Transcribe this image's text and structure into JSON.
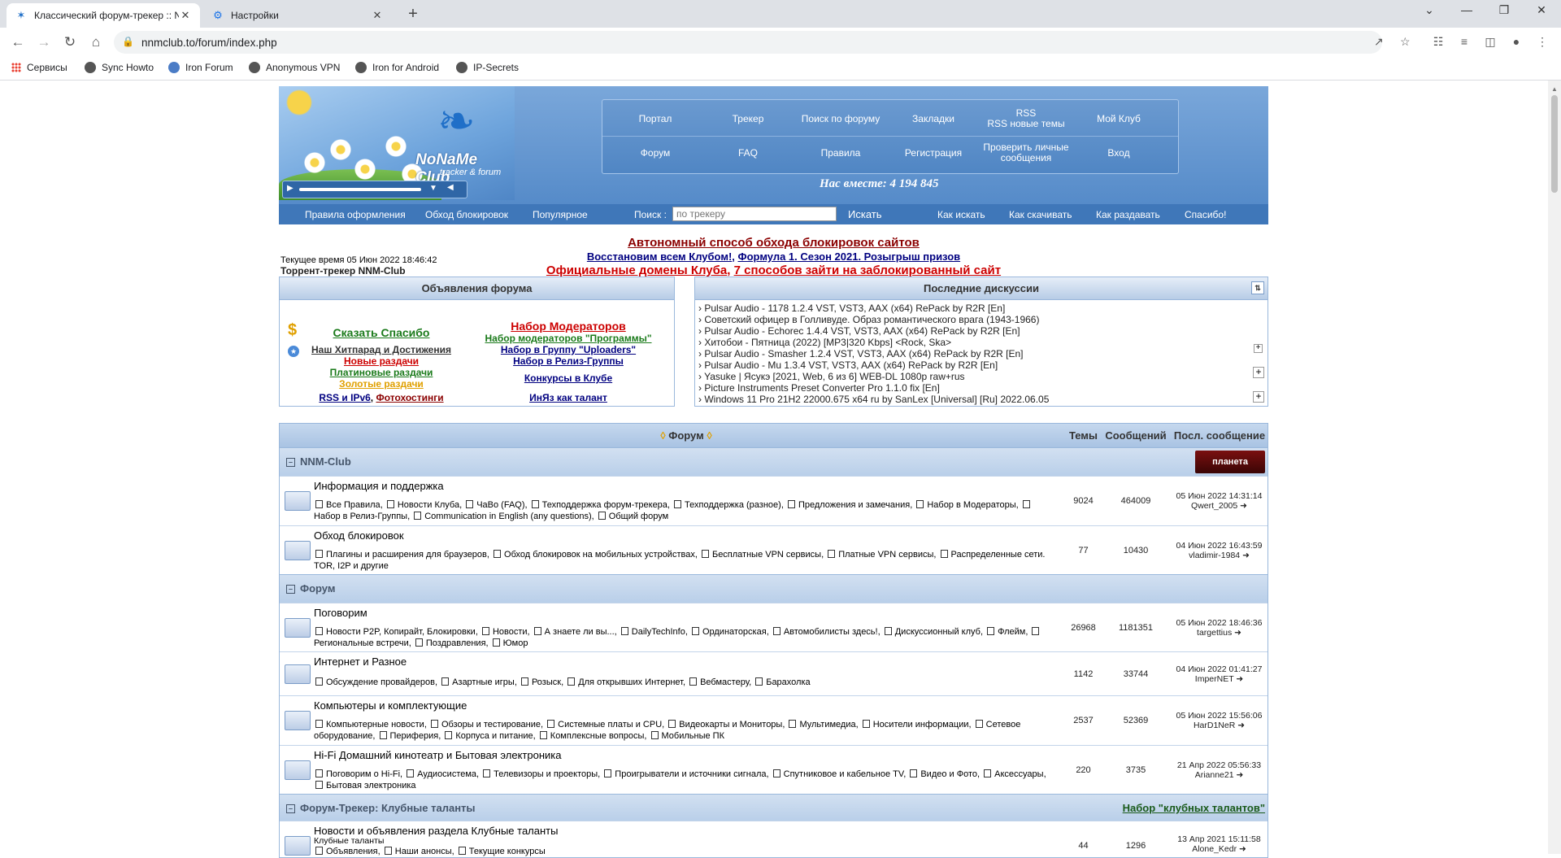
{
  "browser": {
    "tabs": [
      {
        "title": "Классический форум-трекер :: N",
        "active": true
      },
      {
        "title": "Настройки",
        "active": false
      }
    ],
    "url": "nnmclub.to/forum/index.php",
    "bookmarks": [
      "Сервисы",
      "Sync Howto",
      "Iron Forum",
      "Anonymous VPN",
      "Iron for Android",
      "IP-Secrets"
    ]
  },
  "header": {
    "logo_text": "NoNaMe Club",
    "logo_sub": "tracker & forum",
    "nav_row1": [
      "Портал",
      "Трекер",
      "Поиск по форуму",
      "Закладки",
      "RSS\nRSS новые темы",
      "Мой Клуб"
    ],
    "nav_row2": [
      "Форум",
      "FAQ",
      "Правила",
      "Регистрация",
      "Проверить личные сообщения",
      "Вход"
    ],
    "together": "Нас вместе: 4 194 845"
  },
  "menubar": {
    "left": [
      "Правила оформления",
      "Обход блокировок",
      "Популярное"
    ],
    "search_label": "Поиск :",
    "search_placeholder": "по трекеру",
    "search_button": "Искать",
    "right": [
      "Как искать",
      "Как скачивать",
      "Как раздавать",
      "Спасибо!"
    ]
  },
  "info": {
    "time": "Текущее время 05 Июн 2022 18:46:42",
    "tracker": "Торрент-трекер NNM-Club",
    "announce1": "Автономный способ обхода блокировок сайтов",
    "announce2a": "Восстановим всем Клубом!",
    "announce2b": "Формула 1. Сезон 2021. Розыгрыш призов",
    "announce3a": "Официальные домены Клуба",
    "announce3b": "7 способов зайти на заблокированный сайт"
  },
  "announcements": {
    "title": "Объявления форума",
    "left": [
      {
        "text": "Сказать Спасибо",
        "color": "#1a7a1a"
      },
      {
        "text": "Наш Хитпарад и Достижения",
        "color": "#333333"
      },
      {
        "text": "Новые раздачи",
        "color": "#cc0000"
      },
      {
        "text": "Платиновые раздачи",
        "color": "#1a7a1a"
      },
      {
        "text": "Золотые раздачи",
        "color": "#e0a000"
      },
      {
        "text": "RSS и IPv6",
        "color": "#000080"
      },
      {
        "text": "Фотохостинги",
        "color": "#8b0000"
      }
    ],
    "right": [
      {
        "text": "Набор Модераторов",
        "color": "#cc0000"
      },
      {
        "text": "Набор модераторов \"Программы\"",
        "color": "#1a7a1a"
      },
      {
        "text": "Набор в Группу \"Uploaders\"",
        "color": "#000080"
      },
      {
        "text": "Набор в Релиз-Группы",
        "color": "#000080"
      },
      {
        "text": "Конкурсы в Клубе",
        "color": "#000080"
      },
      {
        "text": "ИнЯз как талант",
        "color": "#000080"
      }
    ]
  },
  "discussions": {
    "title": "Последние дискуссии",
    "items": [
      "Pulsar Audio - 1178 1.2.4 VST, VST3, AAX (x64) RePack by R2R [En]",
      "Советский офицер в Голливуде. Образ романтического врага (1943-1966)",
      "Pulsar Audio - Echorec 1.4.4 VST, VST3, AAX (x64) RePack by R2R [En]",
      "Хитобои - Пятница (2022) [MP3|320 Kbps] <Rock, Ska>",
      "Pulsar Audio - Smasher 1.2.4 VST, VST3, AAX (x64) RePack by R2R [En]",
      "Pulsar Audio - Mu 1.3.4 VST, VST3, AAX (x64) RePack by R2R [En]",
      "Yasuke | Ясукэ [2021, Web, 6 из 6] WEB-DL 1080p raw+rus",
      "Picture Instruments Preset Converter Pro 1.1.0 fix [En]",
      "Windows 11 Pro 21H2 22000.675 x64 ru by SanLex [Universal] [Ru] 2022.06.05"
    ]
  },
  "forum": {
    "headers": {
      "forum": "Форум",
      "topics": "Темы",
      "posts": "Сообщений",
      "last": "Посл. сообщение"
    },
    "badge_text": "планета",
    "categories": [
      {
        "name": "NNM-Club",
        "rows": [
          {
            "title": "Информация и поддержка",
            "subs": [
              "Все Правила",
              "Новости Клуба",
              "ЧаВо (FAQ)",
              "Техподдержка форум-трекера",
              "Техподдержка (разное)",
              "Предложения и замечания",
              "Набор в Модераторы",
              "Набор в Релиз-Группы",
              "Communication in English (any questions)",
              "Общий форум"
            ],
            "topics": "9024",
            "posts": "464009",
            "last_date": "05 Июн 2022 14:31:14",
            "last_user": "Qwert_2005"
          },
          {
            "title": "Обход блокировок",
            "subs": [
              "Плагины и расширения для браузеров",
              "Обход блокировок на мобильных устройствах",
              "Бесплатные VPN сервисы",
              "Платные VPN сервисы",
              "Распределенные сети. TOR, I2P и другие"
            ],
            "topics": "77",
            "posts": "10430",
            "last_date": "04 Июн 2022 16:43:59",
            "last_user": "vladimir-1984"
          }
        ]
      },
      {
        "name": "Форум",
        "rows": [
          {
            "title": "Поговорим",
            "subs": [
              "Новости P2P, Копирайт, Блокировки",
              "Новости",
              "А знаете ли вы...",
              "DailyTechInfo",
              "Ординаторская",
              "Автомобилисты здесь!",
              "Дискуссионный клуб",
              "Флейм",
              "Региональные встречи",
              "Поздравления",
              "Юмор"
            ],
            "topics": "26968",
            "posts": "1181351",
            "last_date": "05 Июн 2022 18:46:36",
            "last_user": "targettius"
          },
          {
            "title": "Интернет и Разное",
            "subs": [
              "Обсуждение провайдеров",
              "Азартные игры",
              "Розыск",
              "Для открывших Интернет",
              "Вебмастеру",
              "Барахолка"
            ],
            "topics": "1142",
            "posts": "33744",
            "last_date": "04 Июн 2022 01:41:27",
            "last_user": "ImperNET"
          },
          {
            "title": "Компьютеры и комплектующие",
            "subs": [
              "Компьютерные новости",
              "Обзоры и тестирование",
              "Системные платы и CPU",
              "Видеокарты и Мониторы",
              "Мультимедиа",
              "Носители информации",
              "Сетевое оборудование",
              "Периферия",
              "Корпуса и питание",
              "Комплексные вопросы",
              "Мобильные ПК"
            ],
            "topics": "2537",
            "posts": "52369",
            "last_date": "05 Июн 2022 15:56:06",
            "last_user": "HarD1NeR"
          },
          {
            "title": "Hi-Fi Домашний кинотеатр и Бытовая электроника",
            "subs": [
              "Поговорим о Hi-Fi",
              "Аудиосистема",
              "Телевизоры и проекторы",
              "Проигрыватели и источники сигнала",
              "Спутниковое и кабельное TV",
              "Видео и Фото",
              "Аксессуары",
              "Бытовая электроника"
            ],
            "topics": "220",
            "posts": "3735",
            "last_date": "21 Апр 2022 05:56:33",
            "last_user": "Arianne21"
          }
        ]
      },
      {
        "name": "Форум-Трекер: Клубные таланты",
        "link": "Набор \"клубных талантов\"",
        "rows": [
          {
            "title": "Новости и объявления раздела Клубные таланты",
            "desc": "Клубные таланты",
            "subs": [
              "Объявления",
              "Наши анонсы",
              "Текущие конкурсы"
            ],
            "topics": "44",
            "posts": "1296",
            "last_date": "13 Апр 2021 15:11:58",
            "last_user": "Alone_Kedr"
          }
        ]
      }
    ]
  }
}
